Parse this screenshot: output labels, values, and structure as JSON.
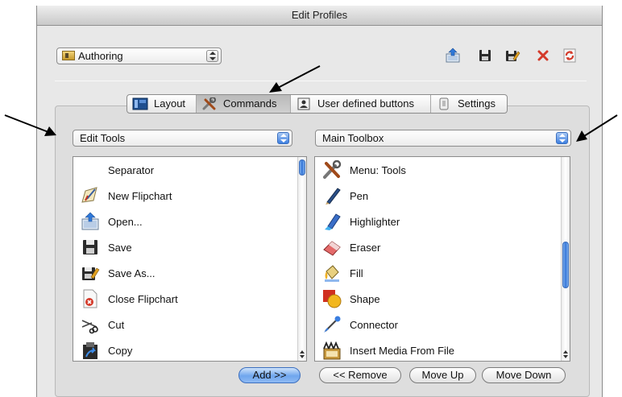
{
  "window": {
    "title": "Edit Profiles"
  },
  "profile": {
    "selected": "Authoring"
  },
  "toolbar": {
    "icons": [
      "upload-icon",
      "save-icon",
      "save-as-icon",
      "delete-icon",
      "refresh-icon"
    ]
  },
  "tabs": [
    {
      "label": "Layout",
      "icon": "layout-icon",
      "selected": false
    },
    {
      "label": "Commands",
      "icon": "tools-icon",
      "selected": true
    },
    {
      "label": "User defined buttons",
      "icon": "user-defined-icon",
      "selected": false
    },
    {
      "label": "Settings",
      "icon": "settings-icon",
      "selected": false
    }
  ],
  "left_panel": {
    "category": "Edit Tools",
    "items": [
      {
        "label": "Separator",
        "icon": ""
      },
      {
        "label": "New Flipchart",
        "icon": "new-flipchart-icon"
      },
      {
        "label": "Open...",
        "icon": "open-icon"
      },
      {
        "label": "Save",
        "icon": "save-icon"
      },
      {
        "label": "Save As...",
        "icon": "save-as-icon"
      },
      {
        "label": "Close Flipchart",
        "icon": "close-flipchart-icon"
      },
      {
        "label": "Cut",
        "icon": "scissors-icon"
      },
      {
        "label": "Copy",
        "icon": "copy-icon"
      }
    ]
  },
  "right_panel": {
    "toolbox": "Main Toolbox",
    "items": [
      {
        "label": "Menu: Tools",
        "icon": "tools-icon"
      },
      {
        "label": "Pen",
        "icon": "pen-icon"
      },
      {
        "label": "Highlighter",
        "icon": "highlighter-icon"
      },
      {
        "label": "Eraser",
        "icon": "eraser-icon"
      },
      {
        "label": "Fill",
        "icon": "fill-icon"
      },
      {
        "label": "Shape",
        "icon": "shape-icon"
      },
      {
        "label": "Connector",
        "icon": "connector-icon"
      },
      {
        "label": "Insert Media From File",
        "icon": "media-icon"
      }
    ]
  },
  "buttons": {
    "add": "Add >>",
    "remove": "<< Remove",
    "move_up": "Move Up",
    "move_down": "Move Down"
  },
  "colors": {
    "accent": "#3e7fe0",
    "window_bg": "#e8e8e8",
    "delete_red": "#d43a2a"
  }
}
